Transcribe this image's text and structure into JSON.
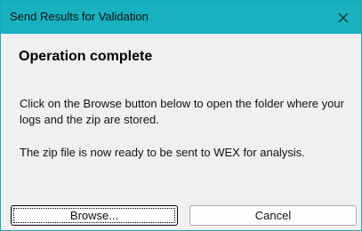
{
  "window": {
    "title": "Send Results for Validation",
    "close_icon": "close-icon"
  },
  "content": {
    "heading": "Operation complete",
    "message_1": "Click on the Browse button below to open the folder where your logs and the zip are stored.",
    "message_2": "The zip file is now ready to be sent to WEX for analysis."
  },
  "buttons": {
    "browse_label": "Browse...",
    "cancel_label": "Cancel"
  },
  "colors": {
    "titlebar": "#18b1bf",
    "dialog_bg": "#f0f0f0"
  }
}
